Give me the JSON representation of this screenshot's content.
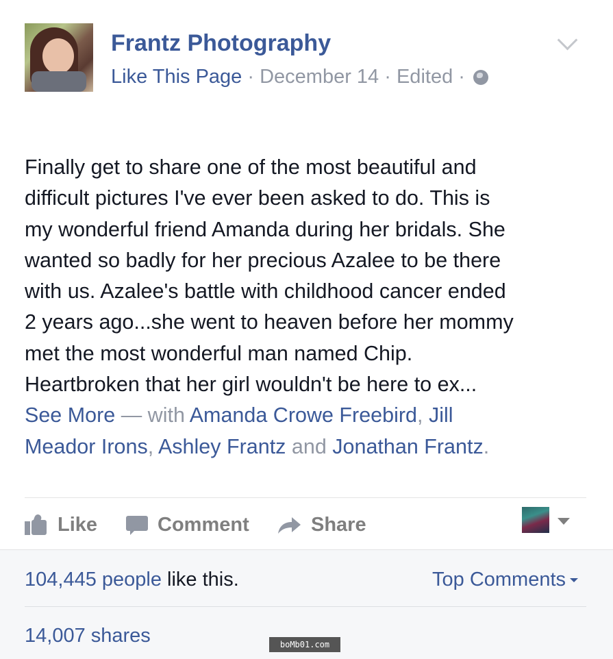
{
  "post": {
    "page_name": "Frantz Photography",
    "meta": {
      "like_link": "Like This Page",
      "sep": " · ",
      "date": "December 14",
      "edited": "Edited"
    },
    "text_lines": [
      "Finally get to share one of the most beautiful and",
      "difficult pictures I've ever been asked to do. This is",
      "my wonderful friend Amanda during her bridals. She",
      "wanted so badly for her precious Azalee to be there",
      "with us. Azalee's battle with childhood cancer ended",
      "2 years ago...she went to heaven before her mommy",
      "met the most wonderful man named Chip.",
      "Heartbroken that her girl wouldn't be here to ex..."
    ],
    "see_more": "See More",
    "dash_with": " — with ",
    "tags": {
      "tag1": "Amanda Crowe Freebird",
      "comma1": ", ",
      "tag2_line1": "Jill",
      "tag2_line2": "Meador Irons",
      "comma2": ", ",
      "tag3": "Ashley Frantz",
      "and": " and ",
      "tag4": "Jonathan Frantz",
      "period": "."
    }
  },
  "actions": {
    "like": "Like",
    "comment": "Comment",
    "share": "Share"
  },
  "footer": {
    "likes_count": "104,445 people",
    "likes_suffix": " like this.",
    "top_comments": "Top Comments",
    "shares": "14,007 shares"
  },
  "watermark": "boMb01.com",
  "colors": {
    "link_blue": "#3b5998",
    "meta_grey": "#9197a3",
    "action_grey": "#7f7f7f",
    "footer_bg": "#f6f7f9"
  },
  "icons": [
    "globe-icon",
    "chevron-down-icon",
    "like-icon",
    "comment-icon",
    "share-icon",
    "caret-down-icon"
  ]
}
